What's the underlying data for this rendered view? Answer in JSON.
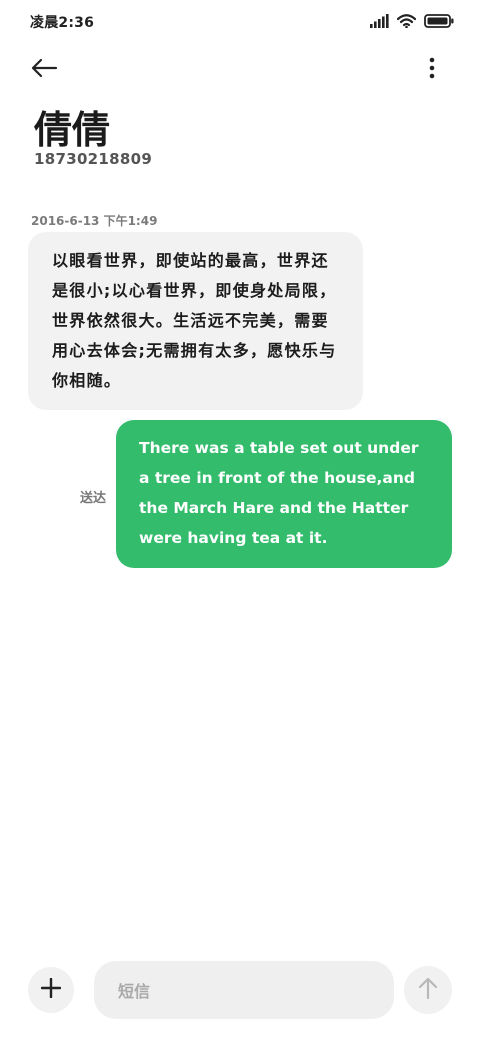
{
  "status_bar": {
    "time": "凌晨2:36",
    "icons": [
      "signal-icon",
      "wifi-icon",
      "battery-icon"
    ]
  },
  "top_bar": {
    "back_icon": "back-arrow-icon",
    "more_icon": "more-vertical-icon"
  },
  "contact": {
    "name": "倩倩",
    "number": "18730218809"
  },
  "conversation": {
    "timestamp": "2016-6-13 下午1:49",
    "messages": [
      {
        "direction": "received",
        "text": "以眼看世界，即使站的最高，世界还是很小;以心看世界，即使身处局限，世界依然很大。生活远不完美，需要用心去体会;无需拥有太多，愿快乐与你相随。"
      },
      {
        "direction": "sent",
        "status": "送达",
        "text": "There was a table set out under a tree in front of the house,and the March Hare and the Hatter were having tea at it."
      }
    ]
  },
  "composer": {
    "add_icon": "plus-icon",
    "placeholder": "短信",
    "send_icon": "send-arrow-up-icon"
  },
  "colors": {
    "sent_bubble": "#32bc6c",
    "received_bubble": "#f2f2f2"
  }
}
